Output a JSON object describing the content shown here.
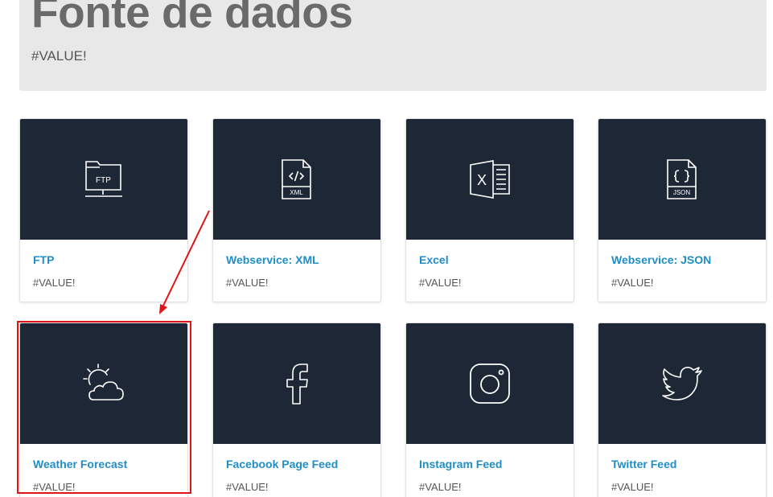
{
  "header": {
    "title": "Fonte de dados",
    "subtitle": "#VALUE!"
  },
  "colors": {
    "card_image_bg": "#1d2735",
    "card_title": "#1f8dc6",
    "header_bg": "#e8e8e8",
    "highlight": "#e01414"
  },
  "cards": [
    {
      "title": "FTP",
      "desc": "#VALUE!",
      "icon": "ftp-folder-icon",
      "icon_text": "FTP"
    },
    {
      "title": "Webservice: XML",
      "desc": "#VALUE!",
      "icon": "xml-file-icon",
      "icon_text": "XML"
    },
    {
      "title": "Excel",
      "desc": "#VALUE!",
      "icon": "excel-icon",
      "icon_text": "X"
    },
    {
      "title": "Webservice: JSON",
      "desc": "#VALUE!",
      "icon": "json-file-icon",
      "icon_text": "JSON"
    },
    {
      "title": "Weather Forecast",
      "desc": "#VALUE!",
      "icon": "weather-icon"
    },
    {
      "title": "Facebook Page Feed",
      "desc": "#VALUE!",
      "icon": "facebook-icon"
    },
    {
      "title": "Instagram Feed",
      "desc": "#VALUE!",
      "icon": "instagram-icon"
    },
    {
      "title": "Twitter Feed",
      "desc": "#VALUE!",
      "icon": "twitter-icon"
    }
  ]
}
